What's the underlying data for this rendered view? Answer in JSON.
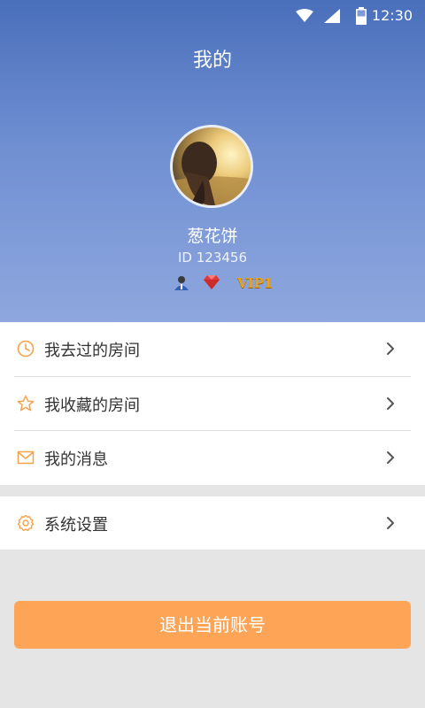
{
  "status_bar": {
    "time": "12:30"
  },
  "page_title": "我的",
  "profile": {
    "username": "葱花饼",
    "user_id": "ID  123456",
    "vip_badge": "VIP1"
  },
  "menu": [
    {
      "label": "我去过的房间",
      "icon": "clock-icon"
    },
    {
      "label": "我收藏的房间",
      "icon": "star-icon"
    },
    {
      "label": "我的消息",
      "icon": "mail-icon"
    }
  ],
  "settings": {
    "label": "系统设置",
    "icon": "gear-icon"
  },
  "logout_label": "退出当前账号",
  "colors": {
    "header_top": "#4a6fba",
    "header_bottom": "#8fa7de",
    "accent_orange": "#fea456",
    "icon_orange": "#f5a34a"
  }
}
